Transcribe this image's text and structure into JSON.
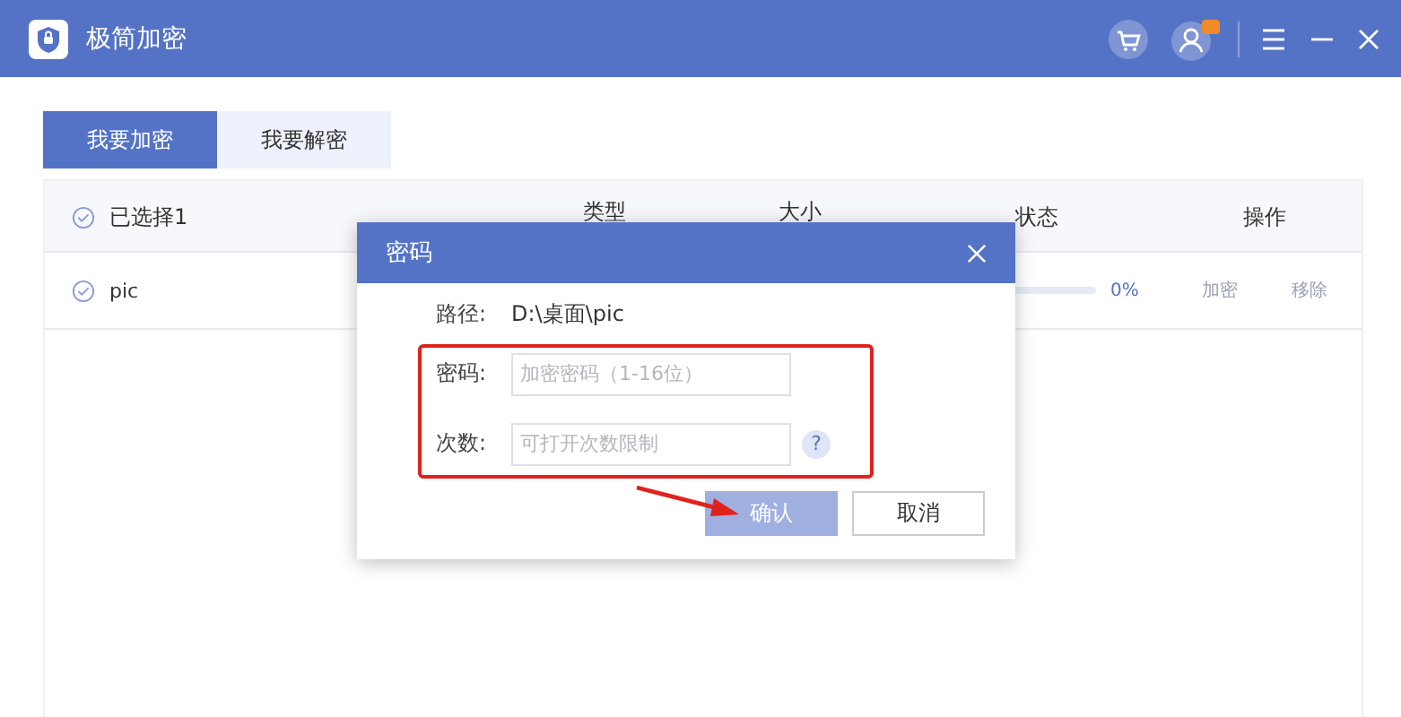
{
  "window": {
    "title": "极简加密"
  },
  "tabs": [
    {
      "label": "我要加密",
      "selected": true
    },
    {
      "label": "我要解密",
      "selected": false
    }
  ],
  "table": {
    "columns": [
      "已选择1",
      "类型",
      "大小",
      "状态",
      "操作"
    ],
    "rows": [
      {
        "name": "pic",
        "level": 0,
        "reading": "0%",
        "actions": [
          {
            "label": "加密",
            "disabled": true
          },
          {
            "label": "移除",
            "disabled": true
          }
        ]
      }
    ]
  },
  "dialog": {
    "title": "密码",
    "path_label": "路径:",
    "path": "D:\\桌面\\pic",
    "fields": [
      {
        "label": "密码:",
        "placeholder": "加密密码（1-16位）",
        "help": false
      },
      {
        "label": "次数:",
        "placeholder": "可打开次数限制",
        "help": true
      }
    ],
    "help_icon": "?",
    "buttons": [
      {
        "label": "确认",
        "kind": "primary",
        "disabled": true
      },
      {
        "label": "取消",
        "kind": "secondary",
        "disabled": false
      }
    ]
  }
}
